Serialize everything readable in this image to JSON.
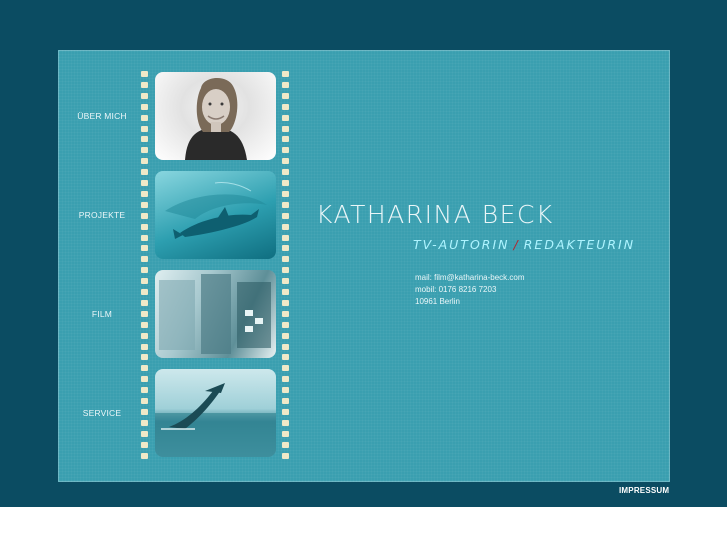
{
  "nav": {
    "items": [
      {
        "label": "ÜBER MICH"
      },
      {
        "label": "PROJEKTE"
      },
      {
        "label": "FILM"
      },
      {
        "label": "SERVICE"
      }
    ]
  },
  "header": {
    "name": "KATHARINA BECK",
    "role_left": "TV-AUTORIN",
    "role_sep": "/",
    "role_right": "REDAKTEURIN"
  },
  "contact": {
    "mail": "mail: film@katharina-beck.com",
    "mobil": "mobil: 0176 8216 7203",
    "address": "10961 Berlin"
  },
  "footer": {
    "impressum": "IMPRESSUM"
  },
  "colors": {
    "background": "#0b4c62",
    "panel": "#3a9fb0",
    "accent_role": "#aef4ff",
    "separator": "#b3262e"
  }
}
